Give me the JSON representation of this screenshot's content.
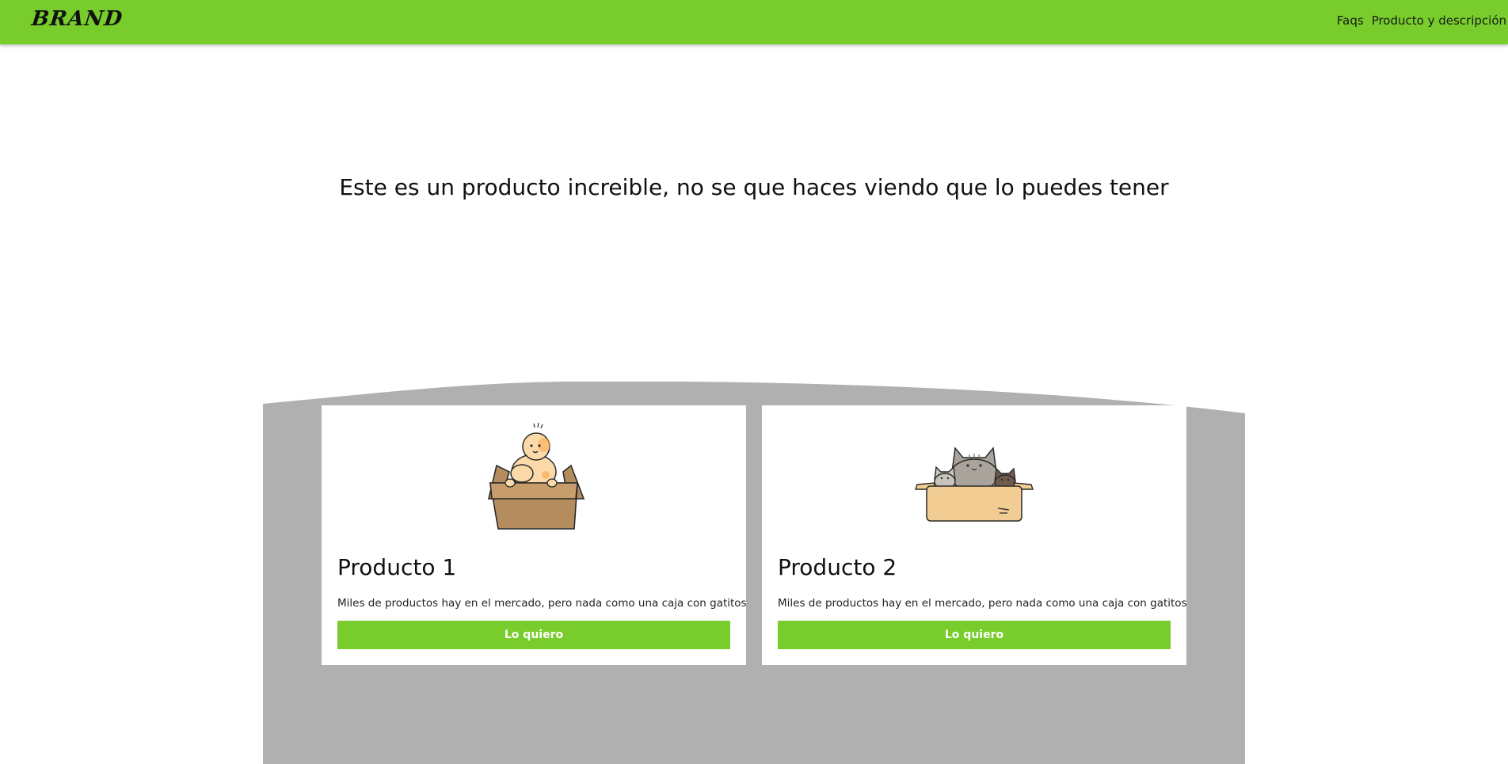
{
  "navbar": {
    "brand": "BRAND",
    "links": [
      {
        "label": "Faqs"
      },
      {
        "label": "Producto y descripción"
      }
    ],
    "color": "#78cd2c"
  },
  "hero": {
    "title": "Este es un producto increible, no se que haces viendo que lo puedes tener"
  },
  "products": [
    {
      "title": "Producto 1",
      "description": "Miles de productos hay en el mercado, pero nada como una caja con gatitos",
      "button_label": "Lo quiero",
      "image": "baby-in-box-illustration"
    },
    {
      "title": "Producto 2",
      "description": "Miles de productos hay en el mercado, pero nada como una caja con gatitos",
      "button_label": "Lo quiero",
      "image": "cats-in-box-illustration"
    }
  ],
  "colors": {
    "accent": "#78cd2c",
    "section_background": "#b0b0b0"
  }
}
